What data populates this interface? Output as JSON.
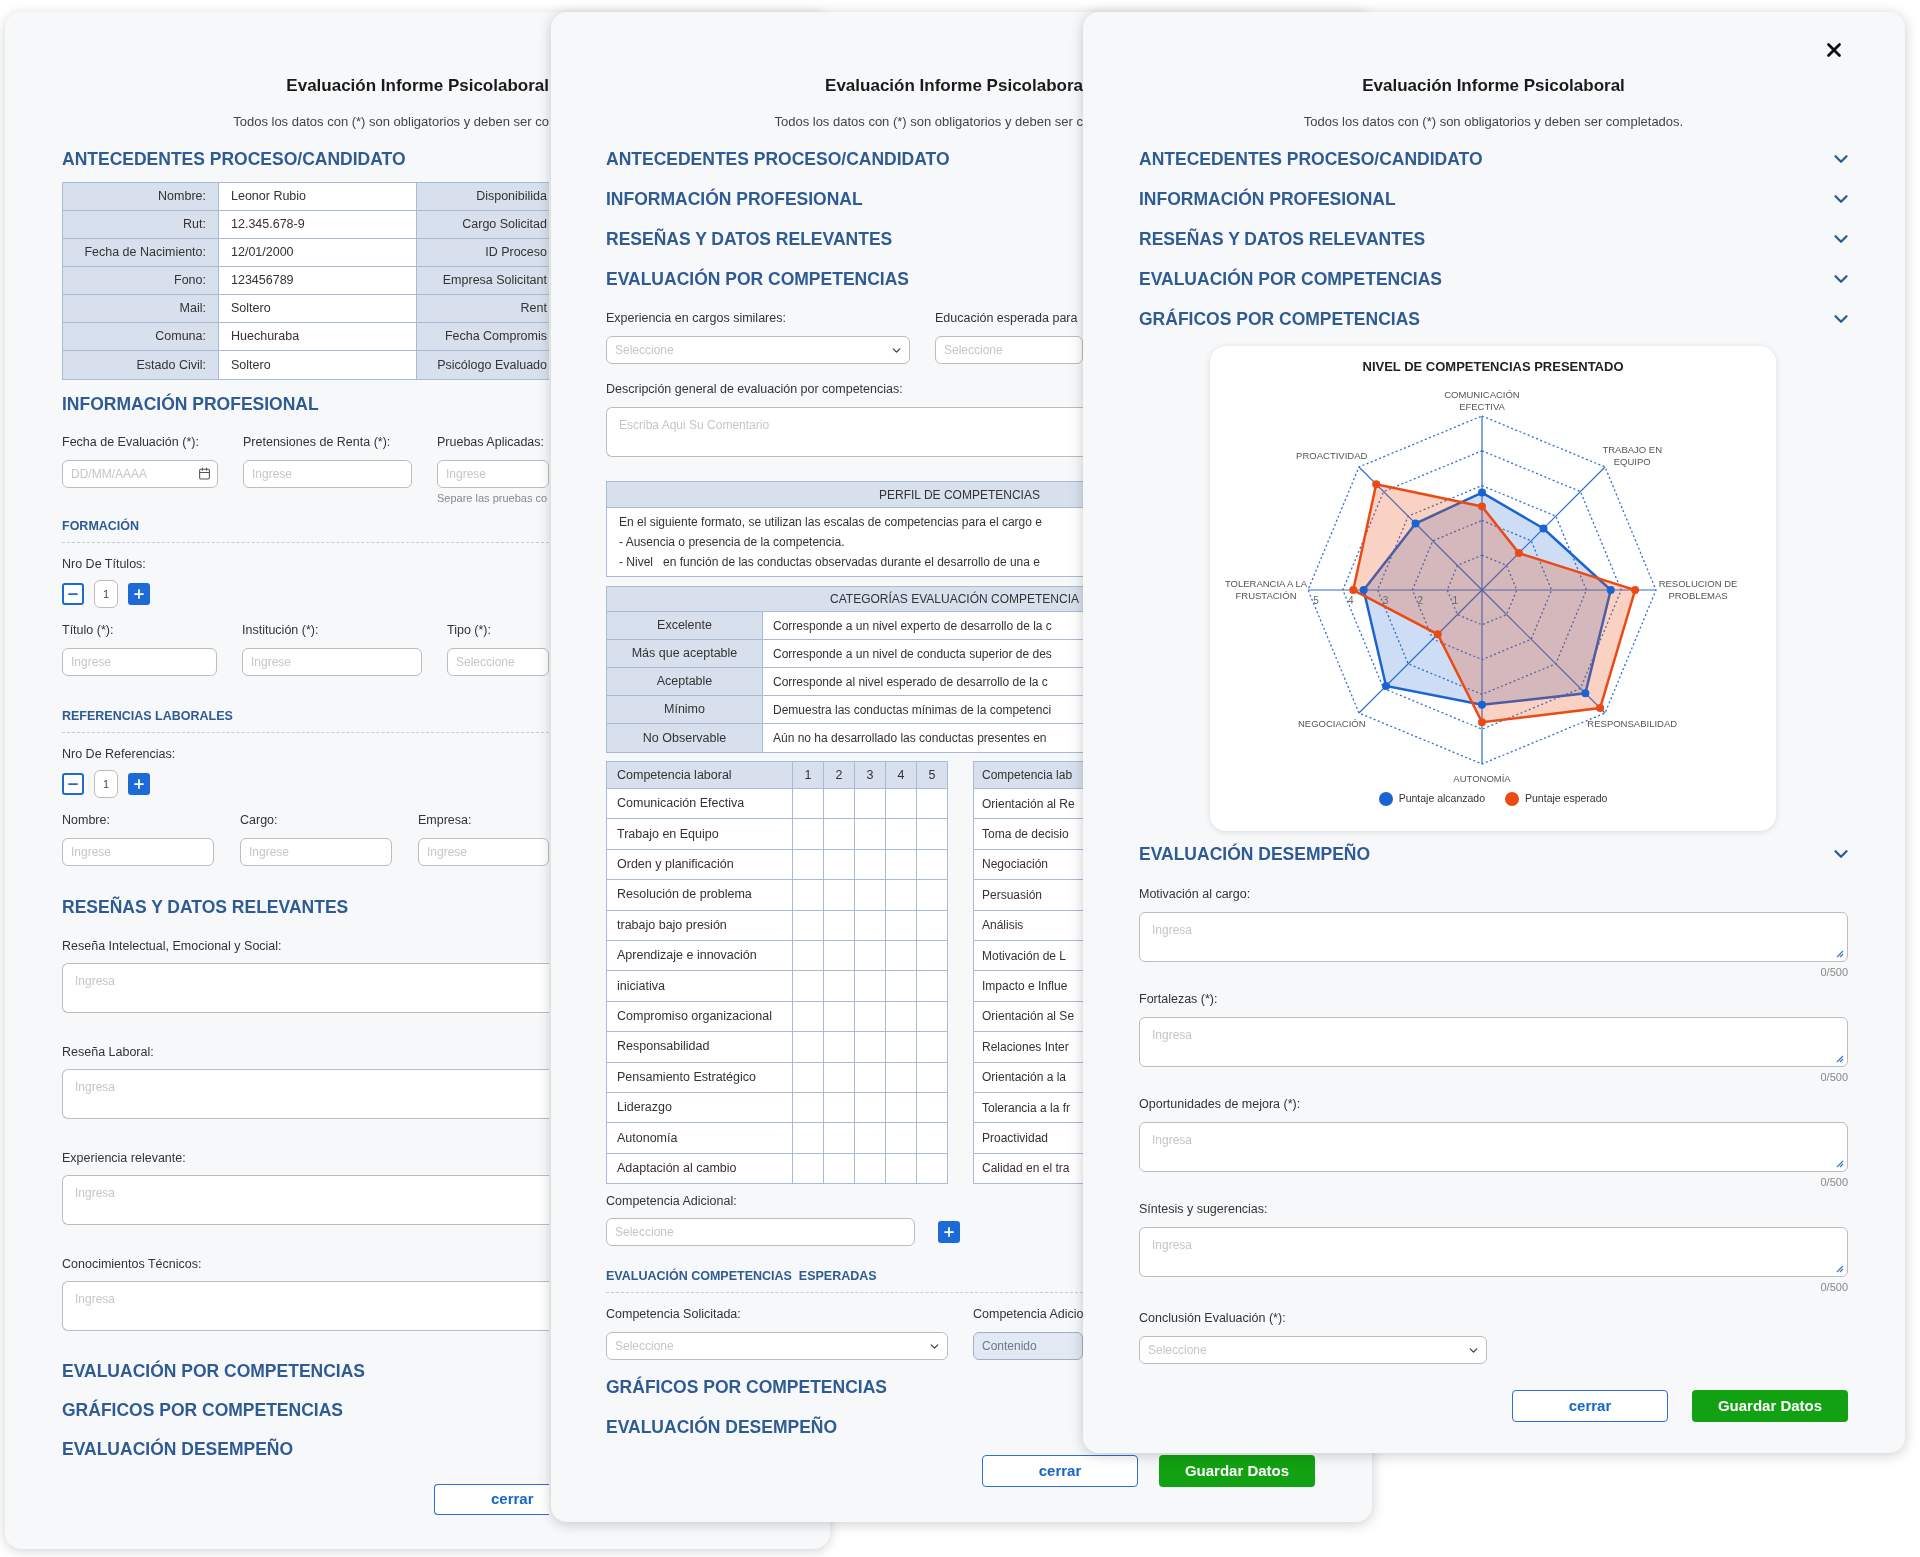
{
  "form_back": {
    "title": "Evaluación Informe Psicolaboral",
    "subtitle": "Todos los datos con (*) son obligatorios y deben ser co",
    "antecedentes": {
      "heading": "ANTECEDENTES PROCESO/CANDIDATO",
      "rows": [
        {
          "label": "Nombre:",
          "value": "Leonor Rubio",
          "label_2": "Disponibilida"
        },
        {
          "label": "Rut:",
          "value": "12.345.678-9",
          "label_2": "Cargo Solicitad"
        },
        {
          "label": "Fecha de Nacimiento:",
          "value": "12/01/2000",
          "label_2": "ID Proceso"
        },
        {
          "label": "Fono:",
          "value": "123456789",
          "label_2": "Empresa Solicitant"
        },
        {
          "label": "Mail:",
          "value": "Soltero",
          "label_2": "Rent"
        },
        {
          "label": "Comuna:",
          "value": "Huechuraba",
          "label_2": "Fecha Compromis"
        },
        {
          "label": "Estado Civil:",
          "value": "Soltero",
          "label_2": "Psicólogo Evaluado"
        }
      ]
    },
    "profesional": {
      "heading": "INFORMACIÓN PROFESIONAL",
      "fields": [
        {
          "label": "Fecha de Evaluación (*):",
          "placeholder": "DD/MM/AAAA",
          "kind": "date"
        },
        {
          "label": "Pretensiones de Renta (*):",
          "placeholder": "Ingrese",
          "kind": "text"
        },
        {
          "label": "Pruebas Aplicadas:",
          "placeholder": "Ingrese",
          "kind": "text",
          "hint": "Separe las pruebas co"
        }
      ]
    },
    "formacion": {
      "heading": "FORMACIÓN",
      "counter_label": "Nro De Títulos:",
      "count": "1",
      "fields": [
        {
          "label": "Título (*):",
          "placeholder": "Ingrese",
          "kind": "text"
        },
        {
          "label": "Institución (*):",
          "placeholder": "Ingrese",
          "kind": "text"
        },
        {
          "label": "Tipo (*):",
          "placeholder": "Seleccione",
          "kind": "text"
        }
      ]
    },
    "referencias": {
      "heading": "REFERENCIAS LABORALES",
      "counter_label": "Nro De Referencias:",
      "count": "1",
      "fields": [
        {
          "label": "Nombre:",
          "placeholder": "Ingrese",
          "kind": "text"
        },
        {
          "label": "Cargo:",
          "placeholder": "Ingrese",
          "kind": "text"
        },
        {
          "label": "Empresa:",
          "placeholder": "Ingrese",
          "kind": "text"
        }
      ]
    },
    "resenas": {
      "heading": "RESEÑAS Y DATOS RELEVANTES",
      "fields": [
        {
          "label": "Reseña Intelectual, Emocional y Social:",
          "placeholder": "Ingresa"
        },
        {
          "label": "Reseña Laboral:",
          "placeholder": "Ingresa"
        },
        {
          "label": "Experiencia relevante:",
          "placeholder": "Ingresa"
        },
        {
          "label": "Conocimientos Técnicos:",
          "placeholder": "Ingresa"
        }
      ]
    },
    "collapsed_sections": [
      "EVALUACIÓN POR COMPETENCIAS",
      "GRÁFICOS POR COMPETENCIAS",
      "EVALUACIÓN DESEMPEÑO"
    ],
    "close_button": "cerrar"
  },
  "form_middle": {
    "title": "Evaluación Informe Psicolabora",
    "subtitle": "Todos los datos con (*) son obligatorios y deben ser c",
    "collapsed_sections_top": [
      "ANTECEDENTES PROCESO/CANDIDATO",
      "INFORMACIÓN PROFESIONAL",
      "RESEÑAS Y DATOS RELEVANTES"
    ],
    "competencias": {
      "heading": "EVALUACIÓN POR COMPETENCIAS",
      "selects": [
        {
          "label": "Experiencia en cargos similares:",
          "placeholder": "Seleccione",
          "kind": "select"
        },
        {
          "label": "Educación esperada para",
          "placeholder": "Seleccione",
          "kind": "text"
        }
      ],
      "description": {
        "label": "Descripción general de evaluación por competencias:",
        "placeholder": "Escriba Aqui Su Comentario"
      },
      "perfil": {
        "heading": "PERFIL DE COMPETENCIAS",
        "lines": [
          "En el siguiente formato, se utilizan las escalas de competencias para el cargo e",
          "- Ausencia o presencia de la competencia.",
          "- Nivel   en función de las conductas observadas durante el desarrollo de una e"
        ]
      },
      "categorias": {
        "heading": "CATEGORÍAS EVALUACIÓN COMPETENCIA",
        "rows": [
          {
            "name": "Excelente",
            "description": "Corresponde a un nivel experto de desarrollo de la c"
          },
          {
            "name": "Más que aceptable",
            "description": "Corresponde a un nivel de conducta superior de des"
          },
          {
            "name": "Aceptable",
            "description": "Corresponde al nivel esperado de desarrollo de la c"
          },
          {
            "name": "Mínimo",
            "description": "Demuestra las conductas mínimas de la competenci"
          },
          {
            "name": "No Observable",
            "description": "Aún no ha desarrollado las conductas presentes en"
          }
        ]
      },
      "scores_table": {
        "columns": [
          "Competencia laboral",
          "1",
          "2",
          "3",
          "4",
          "5"
        ],
        "rows": [
          "Comunicación Efectiva",
          "Trabajo en Equipo",
          "Orden y planificación",
          "Resolución de problema",
          "trabajo bajo presión",
          "Aprendizaje e innovación",
          "iniciativa",
          "Compromiso organizacional",
          "Responsabilidad",
          "Pensamiento Estratégico",
          "Liderazgo",
          "Autonomía",
          "Adaptación al cambio"
        ]
      },
      "scores_table_2": {
        "columns": [
          "Competencia lab"
        ],
        "rows": [
          "Orientación al Re",
          "Toma de decisio",
          "Negociación",
          "Persuasión",
          "Análisis",
          "Motivación de L",
          "Impacto e Influe",
          "Orientación al Se",
          "Relaciones Inter",
          "Orientación a la",
          "Tolerancia a la fr",
          "Proactividad",
          "Calidad en el tra"
        ]
      },
      "adicional": {
        "label": "Competencia Adicional:",
        "placeholder": "Seleccione"
      },
      "esperadas": {
        "heading": "EVALUACIÓN COMPETENCIAS  ESPERADAS",
        "fields": [
          {
            "label": "Competencia Solicitada:",
            "placeholder": "Seleccione",
            "kind": "select"
          },
          {
            "label": "Competencia Adicio",
            "value": "Contenido",
            "kind": "readonly"
          }
        ]
      }
    },
    "collapsed_sections_bottom": [
      "GRÁFICOS POR COMPETENCIAS",
      "EVALUACIÓN DESEMPEÑO"
    ],
    "buttons": [
      {
        "label": "cerrar",
        "kind": "secondary"
      },
      {
        "label": "Guardar Datos",
        "kind": "primary"
      }
    ]
  },
  "form_front": {
    "title": "Evaluación Informe Psicolaboral",
    "subtitle": "Todos los datos con (*) son obligatorios y deben ser completados.",
    "sections": [
      "ANTECEDENTES PROCESO/CANDIDATO",
      "INFORMACIÓN PROFESIONAL",
      "RESEÑAS Y DATOS RELEVANTES",
      "EVALUACIÓN POR COMPETENCIAS",
      "GRÁFICOS POR COMPETENCIAS"
    ],
    "chart_data": {
      "type": "radar",
      "title": "NIVEL DE COMPETENCIAS PRESENTADO",
      "categories": [
        "COMUNICACIÓN EFECTIVA",
        "TRABAJO EN EQUIPO",
        "RESOLUCION DE PROBLEMAS",
        "RESPONSABILIDAD",
        "AUTONOMÍA",
        "NEGOCIACIÓN",
        "TOLERANCIA A LA FRUSTACIÓN",
        "PROACTIVIDAD"
      ],
      "series": [
        {
          "name": "Puntaje alcanzado",
          "color": "#1a63d2",
          "values": [
            2.8,
            2.5,
            3.7,
            4.2,
            3.3,
            3.9,
            3.4,
            2.7
          ]
        },
        {
          "name": "Puntaje esperado",
          "color": "#ec4a15",
          "values": [
            2.4,
            1.5,
            4.4,
            4.8,
            3.8,
            1.8,
            3.7,
            4.3
          ]
        }
      ],
      "ylim": [
        0,
        5
      ],
      "yticks": [
        1,
        2,
        3,
        4,
        5
      ],
      "legend": true
    },
    "desempeno": {
      "heading": "EVALUACIÓN DESEMPEÑO",
      "fields": [
        {
          "label": "Motivación al cargo:",
          "placeholder": "Ingresa",
          "counter": "0/500"
        },
        {
          "label": "Fortalezas (*):",
          "placeholder": "Ingresa",
          "counter": "0/500"
        },
        {
          "label": "Oportunidades de mejora (*):",
          "placeholder": "Ingresa",
          "counter": "0/500"
        },
        {
          "label": "Síntesis y sugerencias:",
          "placeholder": "Ingresa",
          "counter": "0/500"
        }
      ],
      "conclusion": {
        "label": "Conclusión Evaluación (*):",
        "placeholder": "Seleccione"
      }
    },
    "buttons": [
      {
        "label": "cerrar",
        "kind": "secondary"
      },
      {
        "label": "Guardar Datos",
        "kind": "primary"
      }
    ]
  }
}
